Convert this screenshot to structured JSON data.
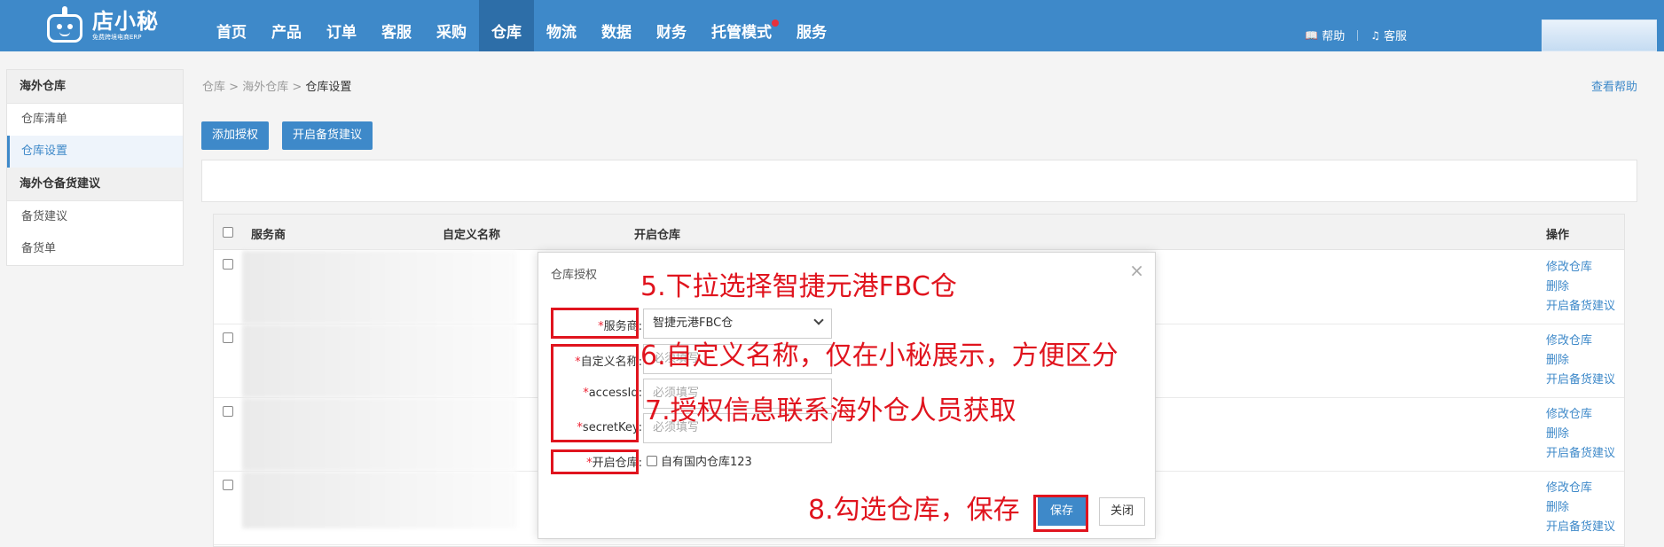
{
  "app": {
    "name": "店小秘",
    "subtitle": "免费跨境电商ERP"
  },
  "nav": [
    {
      "label": "首页"
    },
    {
      "label": "产品"
    },
    {
      "label": "订单"
    },
    {
      "label": "客服"
    },
    {
      "label": "采购"
    },
    {
      "label": "仓库"
    },
    {
      "label": "物流"
    },
    {
      "label": "数据"
    },
    {
      "label": "财务"
    },
    {
      "label": "托管模式"
    },
    {
      "label": "服务"
    }
  ],
  "header": {
    "help": "帮助",
    "service": "客服"
  },
  "sidebar": {
    "group1": "海外仓库",
    "item1": "仓库清单",
    "item2": "仓库设置",
    "group2": "海外仓备货建议",
    "item3": "备货建议",
    "item4": "备货单"
  },
  "breadcrumb": {
    "a": "仓库",
    "b": "海外仓库",
    "current": "仓库设置",
    "sep": ">"
  },
  "help_link": "查看帮助",
  "toolbar": {
    "add_auth": "添加授权",
    "enable_stock": "开启备货建议"
  },
  "table": {
    "headers": {
      "provider": "服务商",
      "custom_name": "自定义名称",
      "open_wh": "开启仓库",
      "ops": "操作"
    },
    "ops": {
      "edit": "修改仓库",
      "delete": "删除",
      "enable": "开启备货建议"
    }
  },
  "modal": {
    "title": "仓库授权",
    "close": "×",
    "provider_label": "服务商:",
    "provider_value": "智捷元港FBC仓",
    "custom_label": "自定义名称:",
    "custom_placeholder": "必须填写",
    "access_label": "accessId:",
    "access_placeholder": "必须填写",
    "secret_label": "secretKey:",
    "secret_placeholder": "必须填写",
    "wh_label": "开启仓库:",
    "wh_option": "自有国内仓库123",
    "save": "保存",
    "cancel": "关闭"
  },
  "annotations": {
    "a5": "5.下拉选择智捷元港FBC仓",
    "a6": "6.自定义名称，仅在小秘展示，方便区分",
    "a7": "7.授权信息联系海外仓人员获取",
    "a8": "8.勾选仓库，保存"
  },
  "colors": {
    "brand": "#3e89c9",
    "annotation": "#e0141e"
  }
}
